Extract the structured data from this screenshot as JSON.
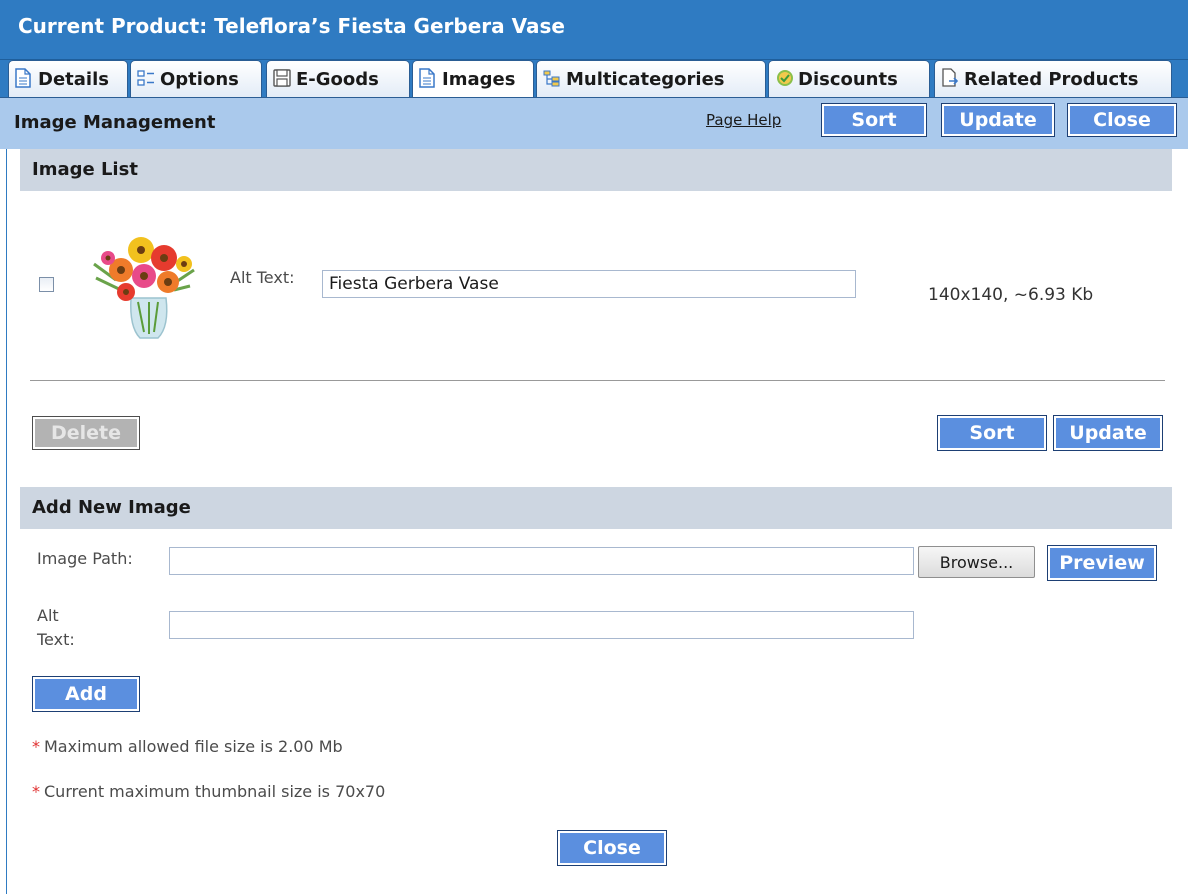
{
  "header": {
    "title": "Current Product: Teleflora’s Fiesta Gerbera Vase"
  },
  "tabs": [
    {
      "label": "Details",
      "icon": "document-icon"
    },
    {
      "label": "Options",
      "icon": "options-icon"
    },
    {
      "label": "E-Goods",
      "icon": "floppy-disk-icon"
    },
    {
      "label": "Images",
      "icon": "document-icon"
    },
    {
      "label": "Multicategories",
      "icon": "category-tree-icon"
    },
    {
      "label": "Discounts",
      "icon": "discount-tag-icon"
    },
    {
      "label": "Related Products",
      "icon": "related-document-icon"
    }
  ],
  "active_tab": "Images",
  "management_bar": {
    "title": "Image Management",
    "page_help": "Page Help",
    "sort_label": "Sort",
    "update_label": "Update",
    "close_label": "Close"
  },
  "image_list": {
    "title": "Image List",
    "items": [
      {
        "checked": false,
        "alt_text_label": "Alt Text:",
        "alt_text_value": "Fiesta Gerbera Vase",
        "info": "140x140, ~6.93 Kb"
      }
    ],
    "delete_label": "Delete",
    "sort_label": "Sort",
    "update_label": "Update"
  },
  "add_image": {
    "title": "Add New Image",
    "image_path_label": "Image Path:",
    "image_path_value": "",
    "browse_label": "Browse...",
    "preview_label": "Preview",
    "alt_text_label_line1": "Alt",
    "alt_text_label_line2": "Text:",
    "alt_text_value": "",
    "add_label": "Add"
  },
  "notes": [
    "Maximum allowed file size is 2.00 Mb",
    "Current maximum thumbnail size is 70x70"
  ],
  "footer": {
    "close_label": "Close"
  },
  "colors": {
    "title_bar": "#2f7bc2",
    "management_bar": "#aac9ec",
    "section_header": "#cdd6e1",
    "button": "#5b8fdf",
    "button_disabled": "#b3b3b3",
    "required_star": "#e03030"
  }
}
